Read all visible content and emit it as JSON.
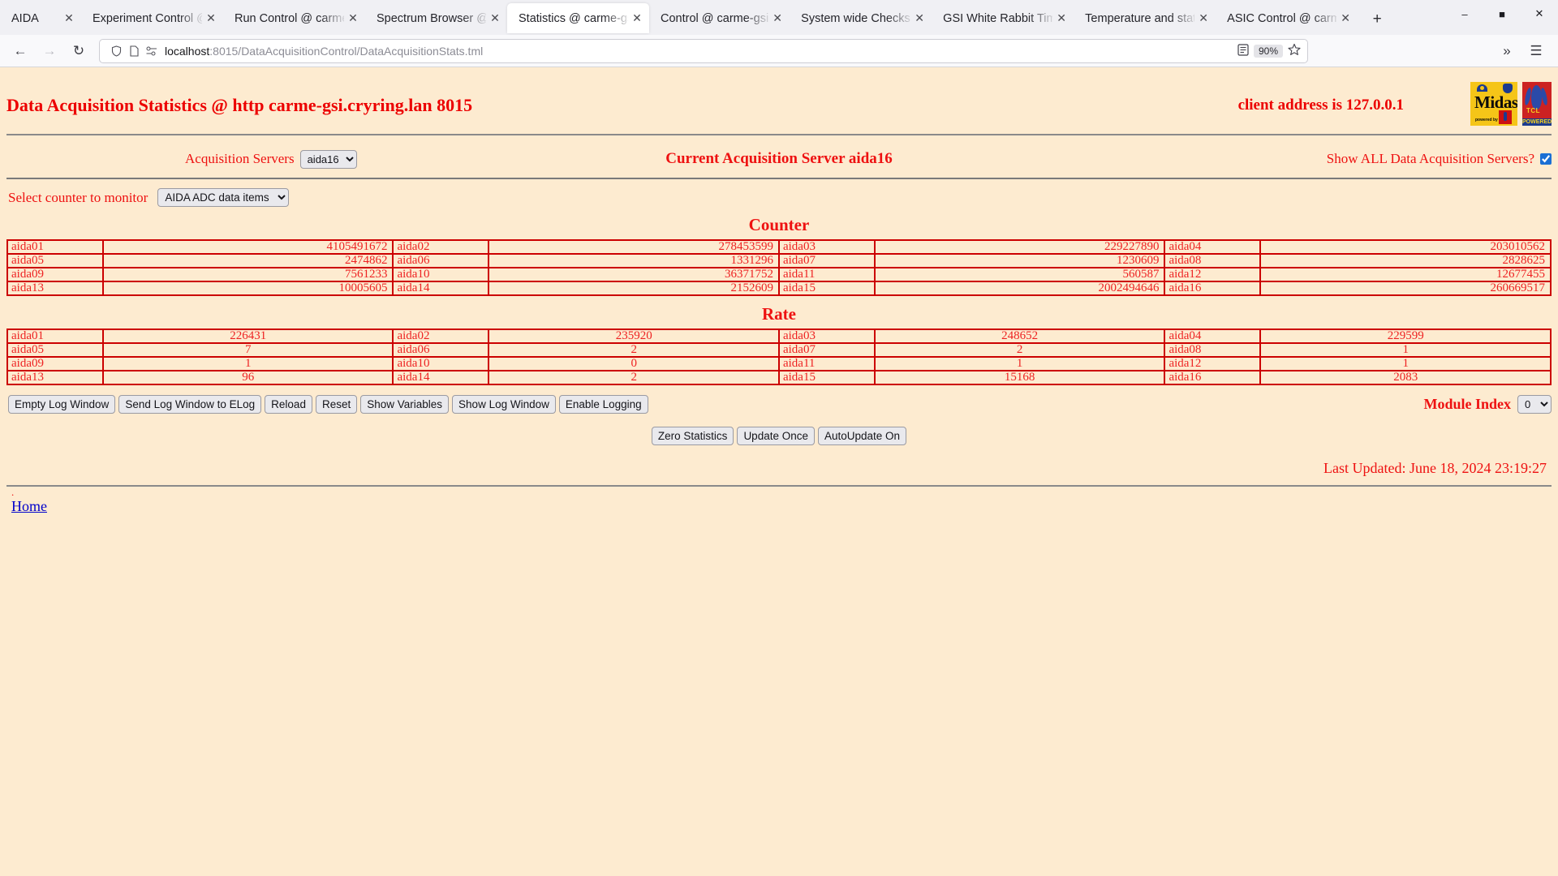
{
  "browser": {
    "tabs": [
      {
        "title": "AIDA",
        "active": false
      },
      {
        "title": "Experiment Control @",
        "active": false
      },
      {
        "title": "Run Control @ carme",
        "active": false
      },
      {
        "title": "Spectrum Browser @ ",
        "active": false
      },
      {
        "title": "Statistics @ carme-gs",
        "active": true
      },
      {
        "title": "Control @ carme-gsi",
        "active": false
      },
      {
        "title": "System wide Checks (",
        "active": false
      },
      {
        "title": "GSI White Rabbit Tim",
        "active": false
      },
      {
        "title": "Temperature and stat",
        "active": false
      },
      {
        "title": "ASIC Control @ carme",
        "active": false
      }
    ],
    "new_tab_label": "+",
    "window_controls": {
      "minimize": "–",
      "maximize": "■",
      "close": "✕"
    },
    "nav": {
      "back": "←",
      "forward": "→",
      "reload": "↻",
      "url_host": "localhost",
      "url_rest": ":8015/DataAcquisitionControl/DataAcquisitionStats.tml",
      "zoom_level": "90%",
      "reader_icon": "reader-mode-icon",
      "bookmark_icon": "star-icon",
      "overflow": "»",
      "menu": "☰"
    }
  },
  "page": {
    "title": "Data Acquisition Statistics @ http carme-gsi.cryring.lan 8015",
    "client_address": "client address is 127.0.0.1",
    "logos": {
      "midas_main": "Midas",
      "midas_sub": "powered by",
      "tcl_label": "TCL",
      "tcl_powered": "POWERED"
    },
    "controls": {
      "acquisition_servers_label": "Acquisition Servers",
      "acquisition_servers_value": "aida16",
      "acquisition_servers_options": [
        "aida16"
      ],
      "current_server_text": "Current Acquisition Server aida16",
      "show_all_label": "Show ALL Data Acquisition Servers?",
      "show_all_checked": true,
      "select_counter_label": "Select counter to monitor",
      "select_counter_value": "AIDA ADC data items",
      "select_counter_options": [
        "AIDA ADC data items"
      ]
    },
    "counter_table": {
      "title": "Counter",
      "rows": [
        [
          {
            "name": "aida01",
            "value": "4105491672"
          },
          {
            "name": "aida02",
            "value": "278453599"
          },
          {
            "name": "aida03",
            "value": "229227890"
          },
          {
            "name": "aida04",
            "value": "203010562"
          }
        ],
        [
          {
            "name": "aida05",
            "value": "2474862"
          },
          {
            "name": "aida06",
            "value": "1331296"
          },
          {
            "name": "aida07",
            "value": "1230609"
          },
          {
            "name": "aida08",
            "value": "2828625"
          }
        ],
        [
          {
            "name": "aida09",
            "value": "7561233"
          },
          {
            "name": "aida10",
            "value": "36371752"
          },
          {
            "name": "aida11",
            "value": "560587"
          },
          {
            "name": "aida12",
            "value": "12677455"
          }
        ],
        [
          {
            "name": "aida13",
            "value": "10005605"
          },
          {
            "name": "aida14",
            "value": "2152609"
          },
          {
            "name": "aida15",
            "value": "2002494646"
          },
          {
            "name": "aida16",
            "value": "260669517"
          }
        ]
      ]
    },
    "rate_table": {
      "title": "Rate",
      "rows": [
        [
          {
            "name": "aida01",
            "value": "226431"
          },
          {
            "name": "aida02",
            "value": "235920"
          },
          {
            "name": "aida03",
            "value": "248652"
          },
          {
            "name": "aida04",
            "value": "229599"
          }
        ],
        [
          {
            "name": "aida05",
            "value": "7"
          },
          {
            "name": "aida06",
            "value": "2"
          },
          {
            "name": "aida07",
            "value": "2"
          },
          {
            "name": "aida08",
            "value": "1"
          }
        ],
        [
          {
            "name": "aida09",
            "value": "1"
          },
          {
            "name": "aida10",
            "value": "0"
          },
          {
            "name": "aida11",
            "value": "1"
          },
          {
            "name": "aida12",
            "value": "1"
          }
        ],
        [
          {
            "name": "aida13",
            "value": "96"
          },
          {
            "name": "aida14",
            "value": "2"
          },
          {
            "name": "aida15",
            "value": "15168"
          },
          {
            "name": "aida16",
            "value": "2083"
          }
        ]
      ]
    },
    "log_buttons": [
      "Empty Log Window",
      "Send Log Window to ELog",
      "Reload",
      "Reset",
      "Show Variables",
      "Show Log Window",
      "Enable Logging"
    ],
    "module_index_label": "Module Index",
    "module_index_value": "0",
    "module_index_options": [
      "0"
    ],
    "action_buttons": [
      "Zero Statistics",
      "Update Once",
      "AutoUpdate On"
    ],
    "last_updated": "Last Updated: June 18, 2024 23:19:27",
    "bullet": ".",
    "home_link": "Home"
  },
  "colors": {
    "page_bg": "#fdebd0",
    "text_red": "#ee1111",
    "border_red": "#cc0000",
    "link_blue": "#0000cc"
  }
}
